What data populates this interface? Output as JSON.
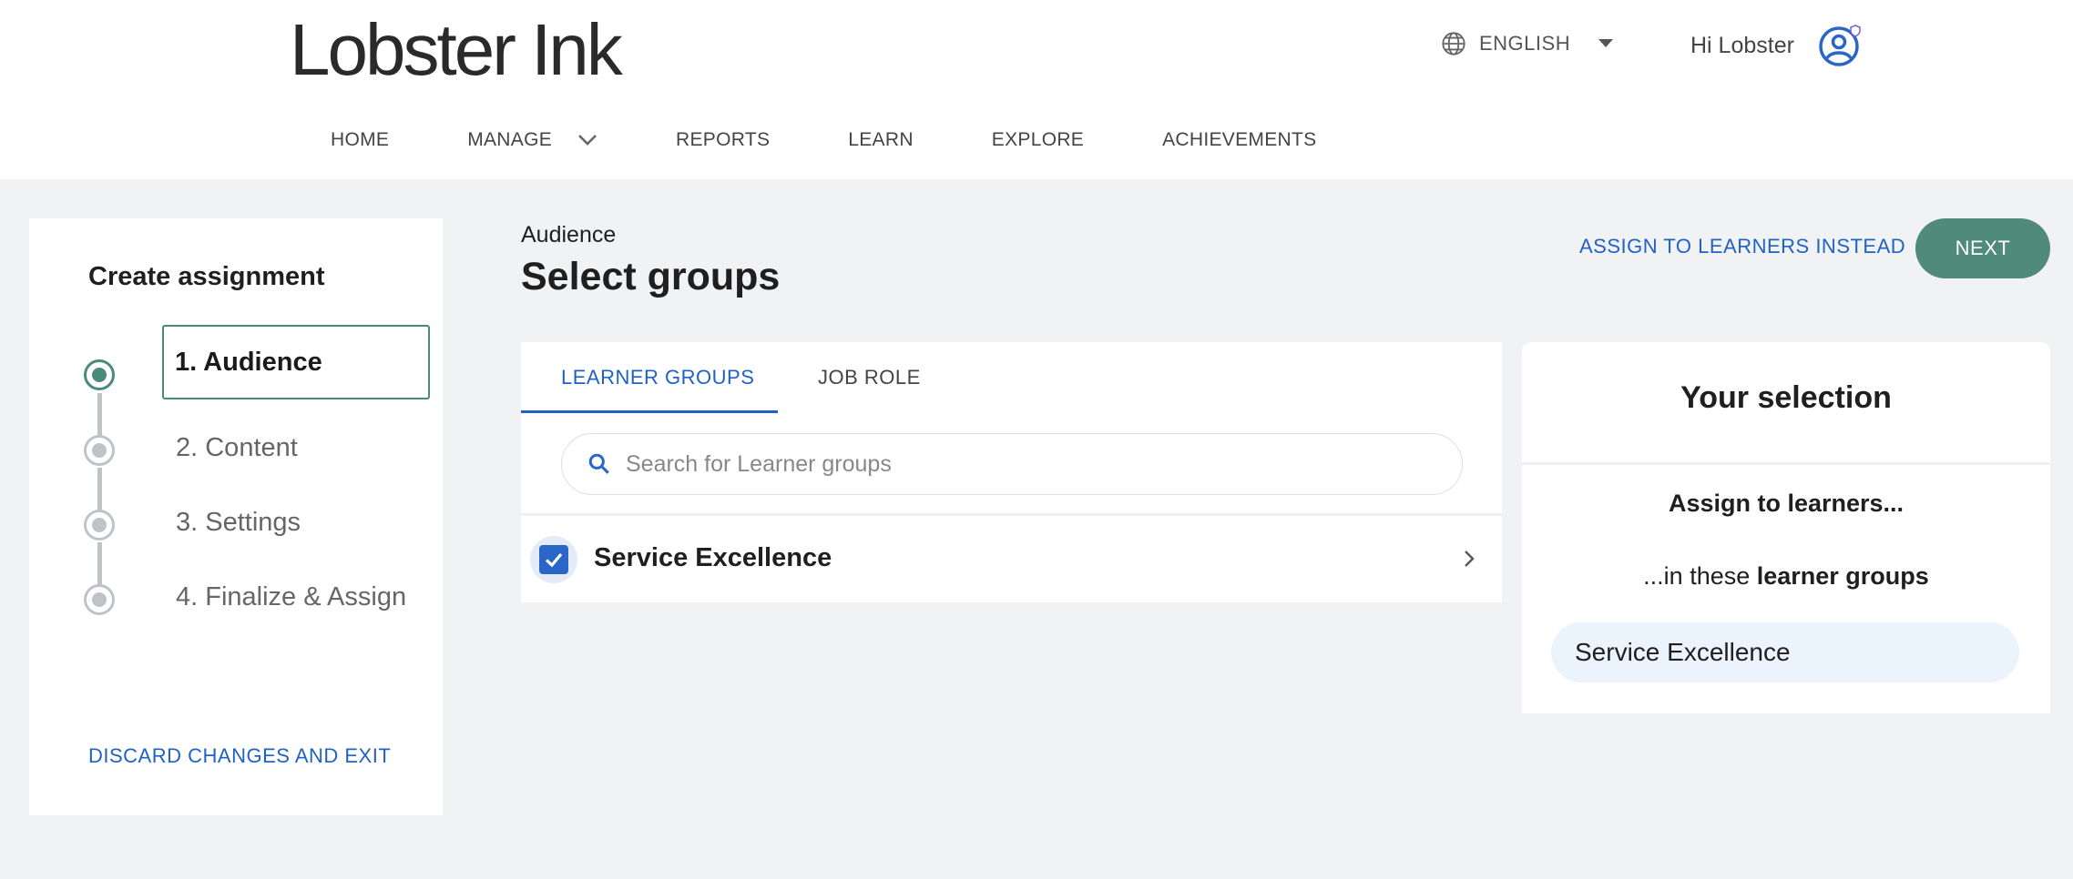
{
  "header": {
    "logo_text": "Lobster Ink",
    "language": "ENGLISH",
    "greeting": "Hi Lobster",
    "icons": {
      "language": "globe-icon",
      "language_dropdown": "chevron-down-icon",
      "avatar": "user-avatar-icon"
    }
  },
  "nav": {
    "items": [
      {
        "label": "HOME"
      },
      {
        "label": "MANAGE"
      },
      {
        "label": "REPORTS"
      },
      {
        "label": "LEARN"
      },
      {
        "label": "EXPLORE"
      },
      {
        "label": "ACHIEVEMENTS"
      }
    ]
  },
  "sidebar": {
    "title": "Create assignment",
    "steps": [
      {
        "label": "1. Audience",
        "active": true
      },
      {
        "label": "2. Content",
        "active": false
      },
      {
        "label": "3. Settings",
        "active": false
      },
      {
        "label": "4. Finalize & Assign",
        "active": false
      }
    ],
    "discard_label": "DISCARD CHANGES AND EXIT"
  },
  "main": {
    "breadcrumb": "Audience",
    "title": "Select groups",
    "assign_instead_label": "ASSIGN TO LEARNERS INSTEAD",
    "next_label": "NEXT",
    "tabs": [
      {
        "label": "LEARNER GROUPS",
        "selected": true
      },
      {
        "label": "JOB ROLE",
        "selected": false
      }
    ],
    "search": {
      "placeholder": "Search for Learner groups",
      "value": ""
    },
    "groups": [
      {
        "name": "Service Excellence",
        "checked": true
      }
    ]
  },
  "selection": {
    "title": "Your selection",
    "assign_text": "Assign to learners...",
    "in_prefix": "...in these ",
    "in_bold": "learner groups",
    "chips": [
      "Service Excellence"
    ]
  },
  "colors": {
    "accent_green": "#4f8a7a",
    "link_blue": "#1f62c4",
    "checkbox_blue": "#2966c8",
    "background": "#f1f2f4"
  }
}
